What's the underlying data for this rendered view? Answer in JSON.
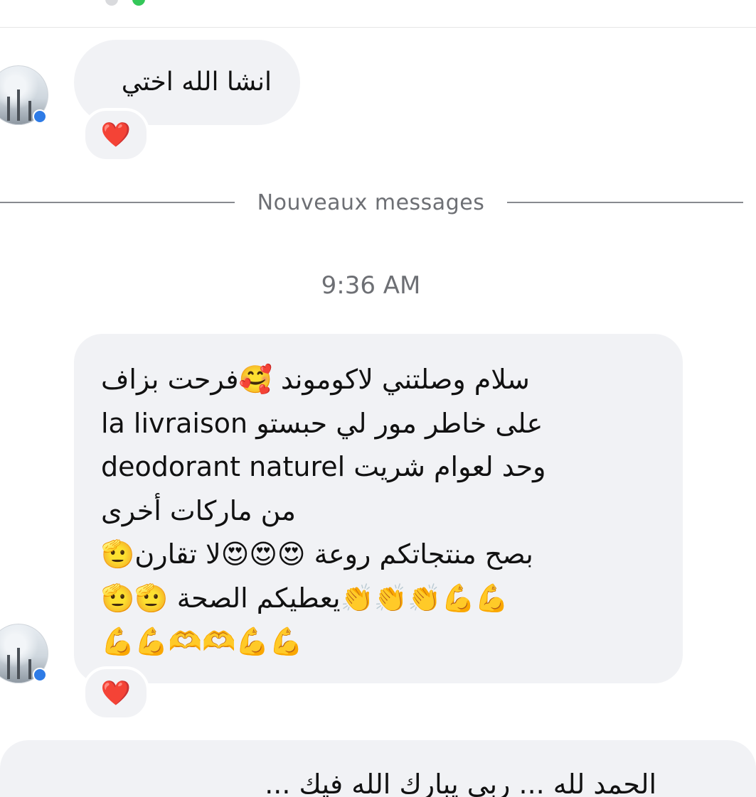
{
  "conversation": {
    "messages": [
      {
        "text": "انشا الله اختي",
        "reaction": "❤️"
      },
      {
        "lines": [
          "سلام وصلتني لاكوموند 🥰فرحت بزاف",
          "على خاطر مور لي حبستو la livraison",
          "وحد لعوام شريت deodorant naturel",
          "من ماركات أخرى",
          "بصح منتجاتكم روعة 😍😍😍لا تقارن🫡",
          "💪💪👏👏👏يعطيكم الصحة 🫡🫡",
          "💪💪🫶🫶💪💪"
        ],
        "reaction": "❤️"
      },
      {
        "text": "الحمد لله ... ربي يبارك الله فيك ..."
      }
    ],
    "new_messages_label": "Nouveaux messages",
    "timestamp": "9:36 AM"
  }
}
